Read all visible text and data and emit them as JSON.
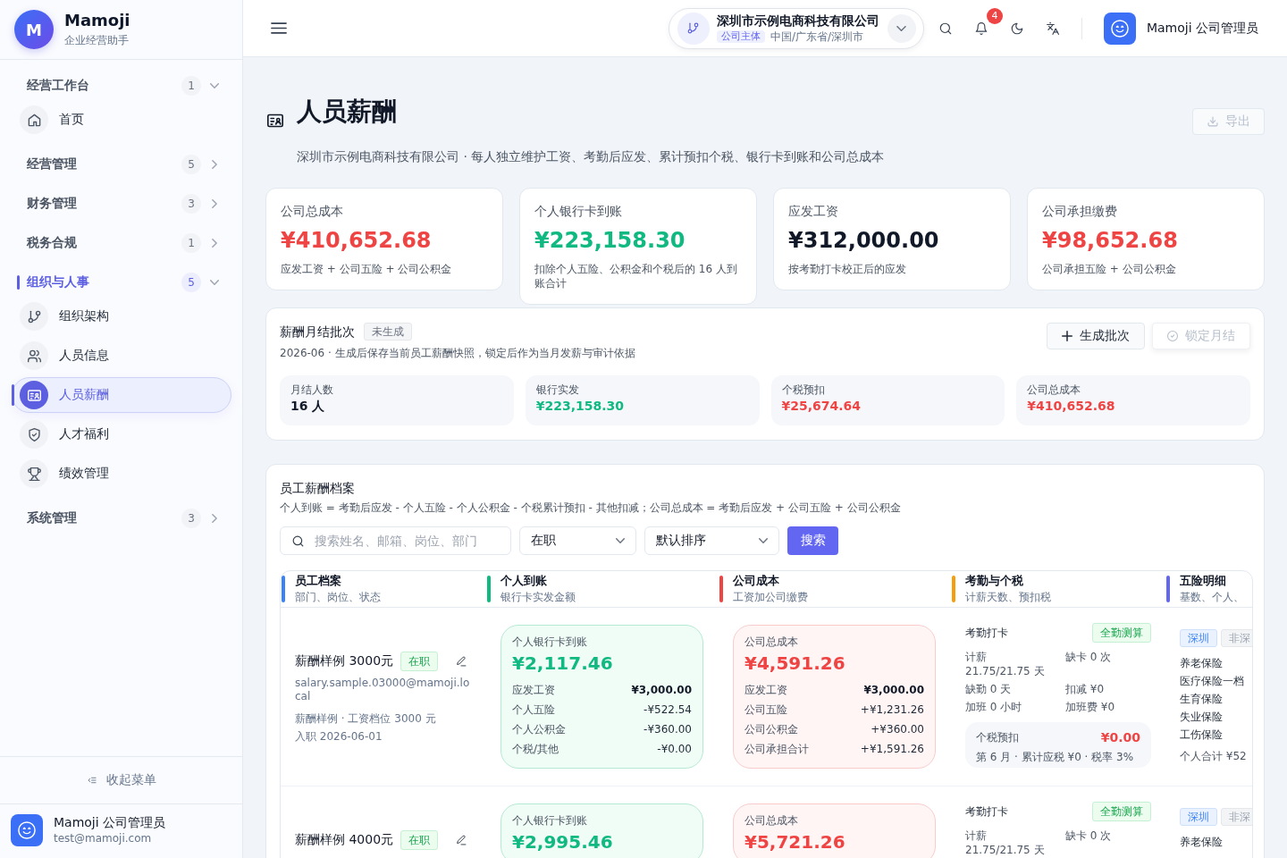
{
  "sidebar": {
    "brand": {
      "logo": "M",
      "name": "Mamoji",
      "tagline": "企业经营助手"
    },
    "groups": [
      {
        "label": "经营工作台",
        "count": "1",
        "expanded": true,
        "active": false,
        "children": [
          {
            "label": "首页",
            "selected": false
          }
        ]
      },
      {
        "label": "经营管理",
        "count": "5",
        "expanded": false,
        "active": false
      },
      {
        "label": "财务管理",
        "count": "3",
        "expanded": false,
        "active": false
      },
      {
        "label": "税务合规",
        "count": "1",
        "expanded": false,
        "active": false
      },
      {
        "label": "组织与人事",
        "count": "5",
        "expanded": true,
        "active": true,
        "children": [
          {
            "label": "组织架构",
            "selected": false
          },
          {
            "label": "人员信息",
            "selected": false
          },
          {
            "label": "人员薪酬",
            "selected": true
          },
          {
            "label": "人才福利",
            "selected": false
          },
          {
            "label": "绩效管理",
            "selected": false
          }
        ]
      },
      {
        "label": "系统管理",
        "count": "3",
        "expanded": false,
        "active": false
      }
    ],
    "collapse": "收起菜单",
    "user": {
      "name": "Mamoji 公司管理员",
      "email": "test@mamoji.com"
    }
  },
  "topbar": {
    "company": {
      "name": "深圳市示例电商科技有限公司",
      "tag": "公司主体",
      "region": "中国/广东省/深圳市"
    },
    "notifications": "4",
    "user": "Mamoji 公司管理员"
  },
  "page": {
    "title": "人员薪酬",
    "subtitle": "深圳市示例电商科技有限公司 · 每人独立维护工资、考勤后应发、累计预扣个税、银行卡到账和公司总成本",
    "export": {
      "label": "导出",
      "disabled": true
    }
  },
  "summary_cards": [
    {
      "label": "公司总成本",
      "value": "¥410,652.68",
      "color": "#ef4444",
      "note": "应发工资 + 公司五险 + 公司公积金"
    },
    {
      "label": "个人银行卡到账",
      "value": "¥223,158.30",
      "color": "#10b981",
      "note": "扣除个人五险、公积金和个税后的 16 人到账合计"
    },
    {
      "label": "应发工资",
      "value": "¥312,000.00",
      "color": "#111827",
      "note": "按考勤打卡校正后的应发"
    },
    {
      "label": "公司承担缴费",
      "value": "¥98,652.68",
      "color": "#ef4444",
      "note": "公司承担五险 + 公司公积金"
    }
  ],
  "batch": {
    "title": "薪酬月结批次",
    "status": "未生成",
    "description": "2026-06 · 生成后保存当前员工薪酬快照，锁定后作为当月发薪与审计依据",
    "actions": [
      {
        "label": "生成批次",
        "kind": "generate",
        "disabled": false
      },
      {
        "label": "锁定月结",
        "kind": "lock",
        "disabled": true
      }
    ],
    "stats": [
      {
        "label": "月结人数",
        "value": "16 人",
        "color": "#111827"
      },
      {
        "label": "银行实发",
        "value": "¥223,158.30",
        "color": "#10b981"
      },
      {
        "label": "个税预扣",
        "value": "¥25,674.64",
        "color": "#ef4444"
      },
      {
        "label": "公司总成本",
        "value": "¥410,652.68",
        "color": "#ef4444"
      }
    ]
  },
  "archive": {
    "title": "员工薪酬档案",
    "formula": "个人到账 = 考勤后应发 - 个人五险 - 个人公积金 - 个税累计预扣 - 其他扣减；公司总成本 = 考勤后应发 + 公司五险 + 公司公积金",
    "filters": {
      "search": {
        "placeholder": "搜索姓名、邮箱、岗位、部门"
      },
      "status_select": "在职",
      "sort_select": "默认排序",
      "button": "搜索"
    },
    "table": {
      "columns": [
        {
          "title": "员工档案",
          "subtitle": "部门、岗位、状态",
          "color": "#3b82f6"
        },
        {
          "title": "个人到账",
          "subtitle": "银行卡实发金额",
          "color": "#10b981"
        },
        {
          "title": "公司成本",
          "subtitle": "工资加公司缴费",
          "color": "#ef4444"
        },
        {
          "title": "考勤与个税",
          "subtitle": "计薪天数、预扣税",
          "color": "#f59e0b"
        },
        {
          "title": "五险明细",
          "subtitle": "基数、个人、",
          "color": "#6366f1"
        }
      ],
      "rows": [
        {
          "employee": {
            "name": "薪酬样例 3000元",
            "status": "在职",
            "email": "salary.sample.03000@mamoji.local",
            "position": "薪酬样例 · 工资档位 3000 元",
            "hired": "入职 2026-06-01"
          },
          "payout": {
            "label": "个人银行卡到账",
            "amount": "¥2,117.46",
            "lines": [
              {
                "label": "应发工资",
                "value": "¥3,000.00",
                "emphasis": true
              },
              {
                "label": "个人五险",
                "value": "-¥522.54",
                "emphasis": false
              },
              {
                "label": "个人公积金",
                "value": "-¥360.00",
                "emphasis": false
              },
              {
                "label": "个税/其他",
                "value": "-¥0.00",
                "emphasis": false
              }
            ]
          },
          "cost": {
            "label": "公司总成本",
            "amount": "¥4,591.26",
            "lines": [
              {
                "label": "应发工资",
                "value": "¥3,000.00",
                "emphasis": true
              },
              {
                "label": "公司五险",
                "value": "+¥1,231.26",
                "emphasis": false
              },
              {
                "label": "公司公积金",
                "value": "+¥360.00",
                "emphasis": false
              },
              {
                "label": "公司承担合计",
                "value": "+¥1,591.26",
                "emphasis": false
              }
            ]
          },
          "attendance": {
            "title": "考勤打卡",
            "tag": "全勤测算",
            "stats": [
              "计薪 21.75/21.75 天",
              "缺卡 0 次",
              "缺勤 0 天",
              "扣减 ¥0",
              "加班 0 小时",
              "加班费 ¥0"
            ],
            "tax": {
              "label": "个税预扣",
              "amount": "¥0.00",
              "note": "第 6 月 · 累计应税 ¥0 · 税率 3%"
            }
          },
          "insurance": {
            "regions": [
              {
                "label": "深圳",
                "selected": true
              },
              {
                "label": "非深",
                "selected": false
              }
            ],
            "items": [
              "养老保险",
              "医疗保险一档",
              "生育保险",
              "失业保险",
              "工伤保险"
            ],
            "total": "个人合计 ¥52"
          }
        },
        {
          "employee": {
            "name": "薪酬样例 4000元",
            "status": "在职"
          },
          "payout": {
            "label": "个人银行卡到账",
            "amount": "¥2,995.46"
          },
          "cost": {
            "label": "公司总成本",
            "amount": "¥5,721.26"
          },
          "attendance": {
            "title": "考勤打卡",
            "tag": "全勤测算",
            "stats": [
              "计薪 21.75/21.75 天",
              "缺卡 0 次"
            ]
          },
          "insurance": {
            "regions": [
              {
                "label": "深圳",
                "selected": true
              },
              {
                "label": "非深",
                "selected": false
              }
            ],
            "items": [
              "养老保险"
            ]
          }
        }
      ]
    }
  }
}
